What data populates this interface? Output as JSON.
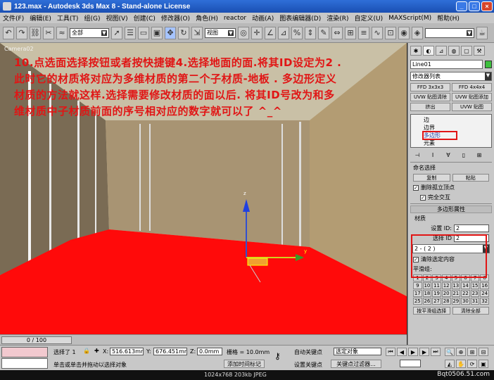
{
  "window": {
    "title": "123.max - Autodesk 3ds Max 8 - Stand-alone License",
    "minimize_label": "_",
    "maximize_label": "□",
    "close_label": "×"
  },
  "menu": [
    "文件(F)",
    "编辑(E)",
    "工具(T)",
    "组(G)",
    "视图(V)",
    "创建(C)",
    "修改器(O)",
    "角色(H)",
    "reactor",
    "动画(A)",
    "图表编辑器(D)",
    "渲染(R)",
    "自定义(U)",
    "MAXScript(M)",
    "帮助(H)"
  ],
  "toolbar": {
    "selection_filter": "全部",
    "ref_coord": "视图"
  },
  "viewport": {
    "label": "Camera02",
    "overlay_text": "10.点选面选择按钮或者按快捷键4.选择地面的面.将其ID设定为2 .此时它的材质将对应为多维材质的第二个子材质-地板 . 多边形定义材质的方法就这样.选择需要修改材质的面以后. 将其ID号改为和多维材质中子材质前面的序号相对应的数字就可以了 ^_^",
    "gizmo_axis_y": "y",
    "gizmo_axis_z": "z"
  },
  "panel": {
    "object_name": "Line01",
    "modifier_list": "修改器列表",
    "modifiers": [
      "FFD 3x3x3",
      "FFD 4x4x4",
      "UVW 贴图清除",
      "UVW 贴图添加",
      "挤出",
      "UVW 贴图"
    ],
    "stack": [
      "边",
      "边界",
      "多边形",
      "元素"
    ],
    "named_sel_label": "命名选择",
    "copy_label": "复制",
    "paste_label": "粘贴",
    "delete_isolated": "删除孤立顶点",
    "full_interact": "完全交互",
    "poly_props_label": "多边形属性",
    "material_label": "材质",
    "set_id_label": "设置 ID:",
    "set_id_value": "2",
    "select_id_label": "选择 ID",
    "select_id_value": "2",
    "material_dropdown": "2 - ( 2 )",
    "clear_selection": "清除选定内容",
    "smoothing_label": "平滑组:",
    "smoothing_numbers": [
      "1",
      "2",
      "3",
      "4",
      "5",
      "6",
      "7",
      "8",
      "9",
      "10",
      "11",
      "12",
      "13",
      "14",
      "15",
      "16",
      "17",
      "18",
      "19",
      "20",
      "21",
      "22",
      "23",
      "24",
      "25",
      "26",
      "27",
      "28",
      "29",
      "30",
      "31",
      "32"
    ],
    "select_by_smooth": "按平滑组选择",
    "clear_all": "清除全部"
  },
  "timeline": {
    "frame_label": "0 / 100"
  },
  "status": {
    "selected": "选择了 1",
    "x_label": "X:",
    "x_value": "516.613mm",
    "y_label": "Y:",
    "y_value": "676.451mm",
    "z_label": "Z:",
    "z_value": "0.0mm",
    "grid": "栅格 = 10.0mm",
    "prompt": "单击或单击并拖动以选择对象",
    "add_time_tag": "添加时间标记",
    "auto_key": "自动关键点",
    "set_key": "设置关键点",
    "selected_obj": "选定对象",
    "key_filters": "关键点过滤器..."
  },
  "footer": {
    "info": "1024x768  203kb  JPEG",
    "site": "Bqt0506.51.com"
  }
}
